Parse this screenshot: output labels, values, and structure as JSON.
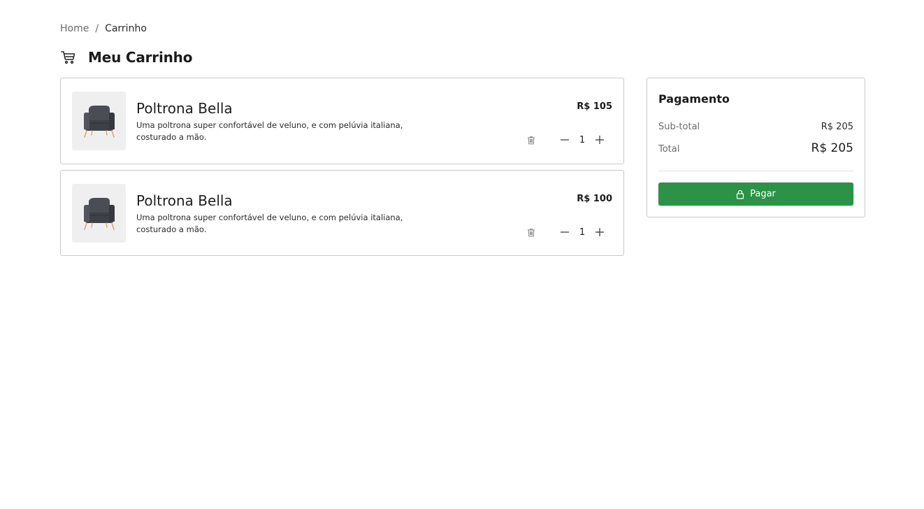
{
  "breadcrumb": {
    "home": "Home",
    "separator": "/",
    "current": "Carrinho"
  },
  "header": {
    "title": "Meu Carrinho",
    "icon": "cart-icon"
  },
  "cart": {
    "items": [
      {
        "name": "Poltrona Bella",
        "description": "Uma poltrona super confortável de veluno, e com pelúvia italiana, costurado a mão.",
        "price": "R$ 105",
        "quantity": "1",
        "image": "armchair-image"
      },
      {
        "name": "Poltrona Bella",
        "description": "Uma poltrona super confortável de veluno, e com pelúvia italiana, costurado a mão.",
        "price": "R$ 100",
        "quantity": "1",
        "image": "armchair-image"
      }
    ]
  },
  "payment": {
    "title": "Pagamento",
    "subtotal_label": "Sub-total",
    "subtotal_value": "R$ 205",
    "total_label": "Total",
    "total_value": "R$ 205",
    "button_label": "Pagar",
    "button_icon": "lock-icon"
  },
  "colors": {
    "accent": "#2b9247",
    "border": "#c9c9c9",
    "muted_text": "#6b6b6b",
    "thumb_bg": "#efefef"
  }
}
